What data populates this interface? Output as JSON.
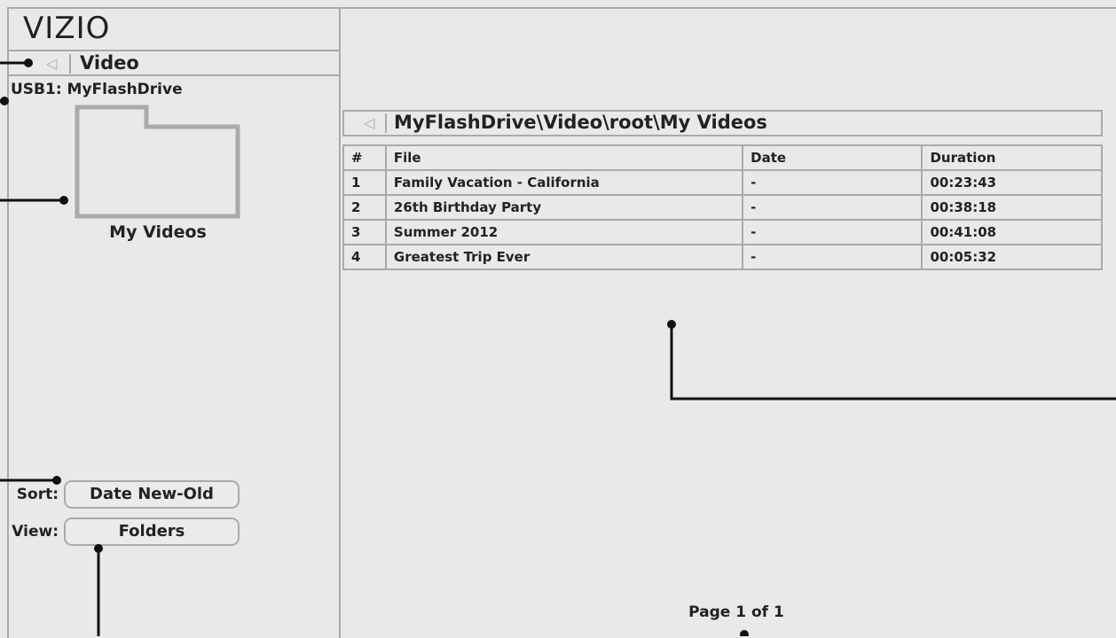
{
  "brand": "VIZIO",
  "nav": {
    "title": "Video",
    "back_icon": "back-arrow-icon"
  },
  "source": {
    "label": "USB1: MyFlashDrive"
  },
  "folder": {
    "name": "My Videos",
    "icon": "folder-icon"
  },
  "options": {
    "sort_label": "Sort:",
    "sort_value": "Date New-Old",
    "view_label": "View:",
    "view_value": "Folders"
  },
  "path": {
    "text": "MyFlashDrive\\Video\\root\\My Videos"
  },
  "table": {
    "headers": [
      "#",
      "File",
      "Date",
      "Duration"
    ],
    "rows": [
      [
        "1",
        "Family Vacation - California",
        "-",
        "00:23:43"
      ],
      [
        "2",
        "26th Birthday Party",
        "-",
        "00:38:18"
      ],
      [
        "3",
        "Summer 2012",
        "-",
        "00:41:08"
      ],
      [
        "4",
        "Greatest Trip Ever",
        "-",
        "00:05:32"
      ]
    ]
  },
  "footer": {
    "page": "Page 1 of 1"
  },
  "colors": {
    "background": "#e9e9e9",
    "border": "#aaaaaa",
    "text": "#222222"
  }
}
